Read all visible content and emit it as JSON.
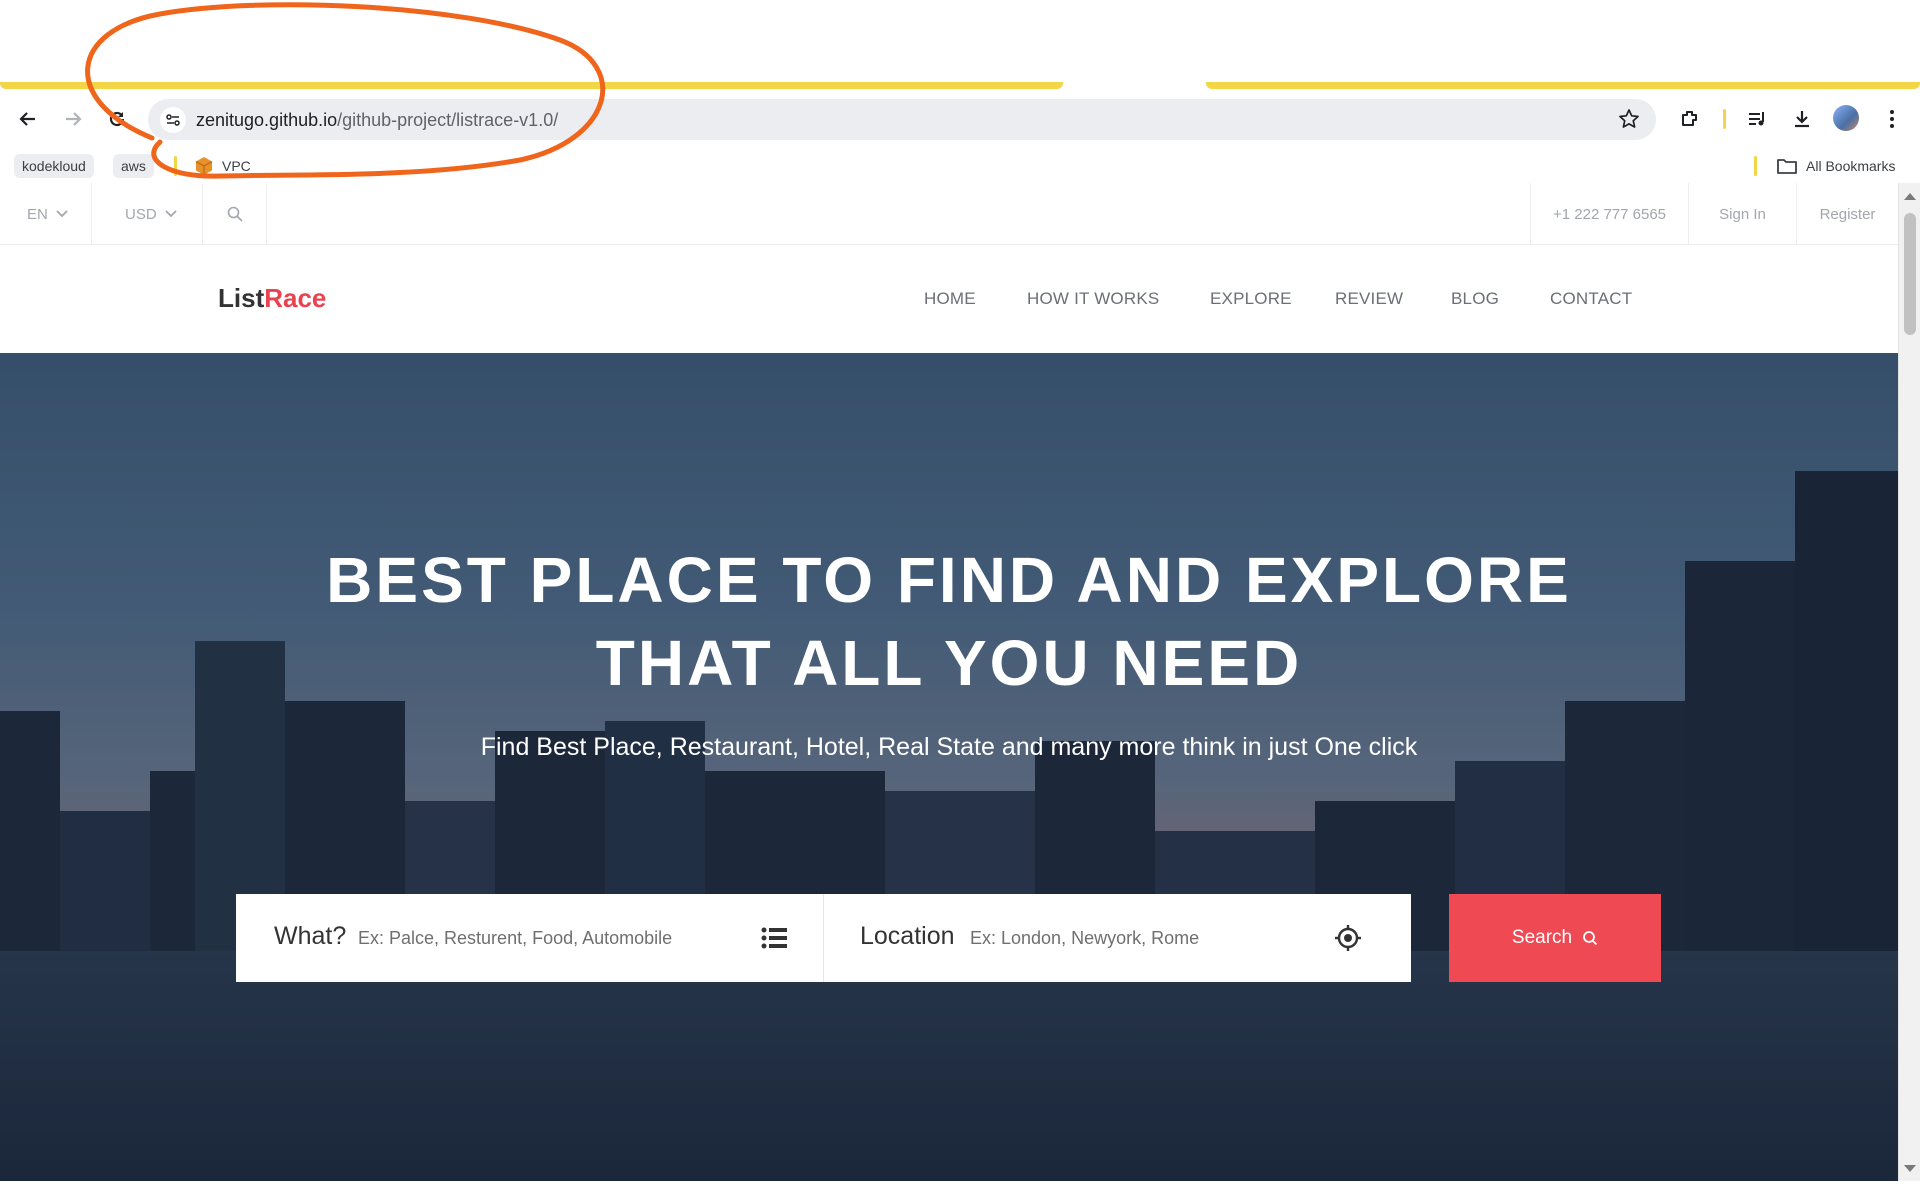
{
  "browser": {
    "url_host": "zenitugo.github.io",
    "url_path": "/github-project/listrace-v1.0/",
    "bookmarks": {
      "items": [
        "kodekloud",
        "aws",
        "VPC"
      ],
      "all_label": "All Bookmarks"
    },
    "accent_color": "#f3d548"
  },
  "site": {
    "topbar": {
      "language": "EN",
      "currency": "USD",
      "phone": "+1 222 777 6565",
      "sign_in": "Sign In",
      "register": "Register"
    },
    "logo": {
      "part1": "List",
      "part2": "Race"
    },
    "menu": [
      "HOME",
      "HOW IT WORKS",
      "EXPLORE",
      "REVIEW",
      "BLOG",
      "CONTACT"
    ],
    "hero": {
      "title_line1": "BEST PLACE TO FIND AND EXPLORE",
      "title_line2": "THAT ALL YOU NEED",
      "subtitle": "Find Best Place, Restaurant, Hotel, Real State and many more think in just One click"
    },
    "search": {
      "what_label": "What?",
      "what_placeholder": "Ex: Palce, Resturent, Food, Automobile",
      "location_label": "Location",
      "location_placeholder": "Ex: London, Newyork, Rome",
      "button_label": "Search"
    },
    "brand_color": "#ef4a54"
  }
}
